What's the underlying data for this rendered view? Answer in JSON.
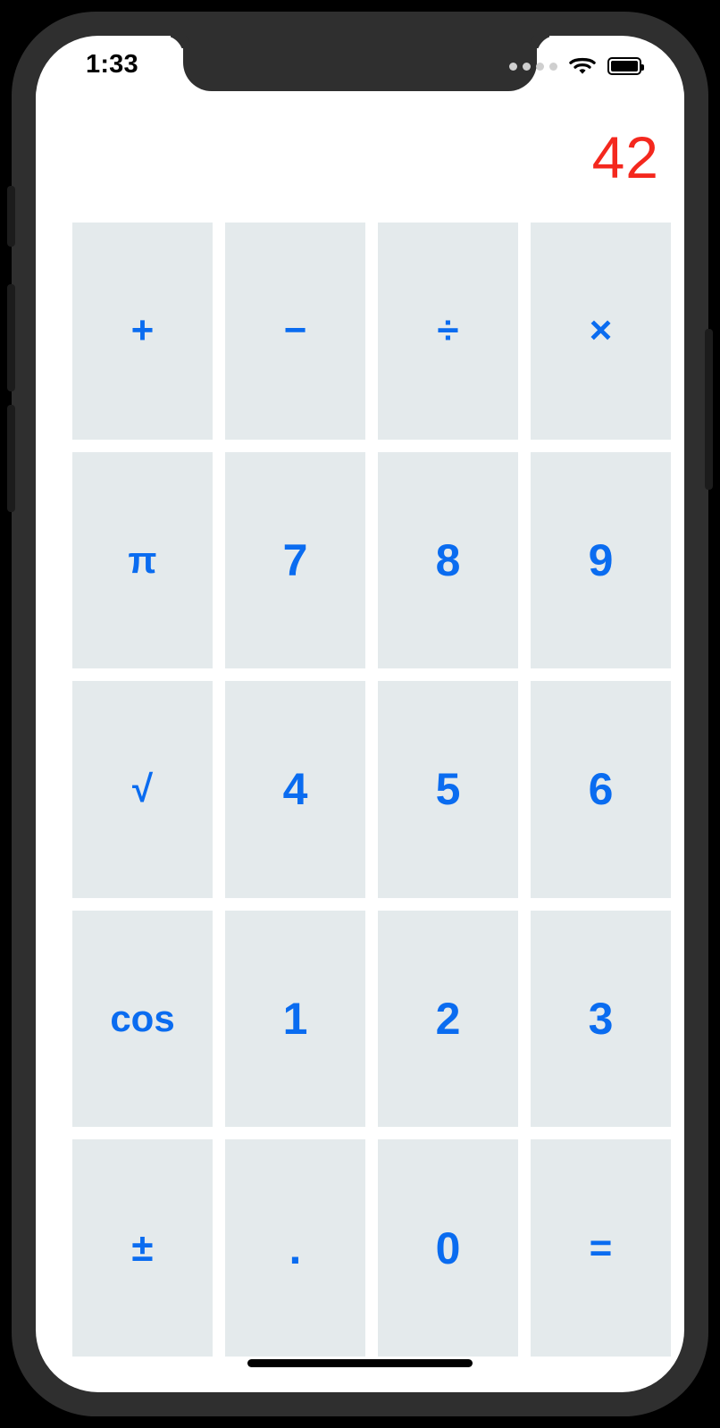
{
  "status_bar": {
    "time": "1:33",
    "signal_dots": 4,
    "wifi_icon": "wifi-icon",
    "battery_icon": "battery-full-icon"
  },
  "display": {
    "value": "42",
    "color": "#f4281e"
  },
  "theme": {
    "key_background": "#e4eaec",
    "key_text": "#0a6cf0",
    "screen_background": "#ffffff",
    "frame": "#2f2f2f"
  },
  "keypad": {
    "rows": [
      [
        {
          "label": "+",
          "name": "key-plus",
          "kind": "op"
        },
        {
          "label": "−",
          "name": "key-minus",
          "kind": "op"
        },
        {
          "label": "÷",
          "name": "key-divide",
          "kind": "op"
        },
        {
          "label": "×",
          "name": "key-multiply",
          "kind": "op"
        }
      ],
      [
        {
          "label": "π",
          "name": "key-pi",
          "kind": "fn"
        },
        {
          "label": "7",
          "name": "key-7",
          "kind": "digit"
        },
        {
          "label": "8",
          "name": "key-8",
          "kind": "digit"
        },
        {
          "label": "9",
          "name": "key-9",
          "kind": "digit"
        }
      ],
      [
        {
          "label": "√",
          "name": "key-sqrt",
          "kind": "fn"
        },
        {
          "label": "4",
          "name": "key-4",
          "kind": "digit"
        },
        {
          "label": "5",
          "name": "key-5",
          "kind": "digit"
        },
        {
          "label": "6",
          "name": "key-6",
          "kind": "digit"
        }
      ],
      [
        {
          "label": "cos",
          "name": "key-cos",
          "kind": "fn"
        },
        {
          "label": "1",
          "name": "key-1",
          "kind": "digit"
        },
        {
          "label": "2",
          "name": "key-2",
          "kind": "digit"
        },
        {
          "label": "3",
          "name": "key-3",
          "kind": "digit"
        }
      ],
      [
        {
          "label": "±",
          "name": "key-plus-minus",
          "kind": "op"
        },
        {
          "label": ".",
          "name": "key-decimal",
          "kind": "dot"
        },
        {
          "label": "0",
          "name": "key-0",
          "kind": "digit"
        },
        {
          "label": "=",
          "name": "key-equals",
          "kind": "op"
        }
      ]
    ]
  },
  "hardware": {
    "silent_switch": "silent-switch",
    "volume_up": "volume-up-button",
    "volume_down": "volume-down-button",
    "power": "power-button",
    "home_indicator": "home-indicator"
  }
}
